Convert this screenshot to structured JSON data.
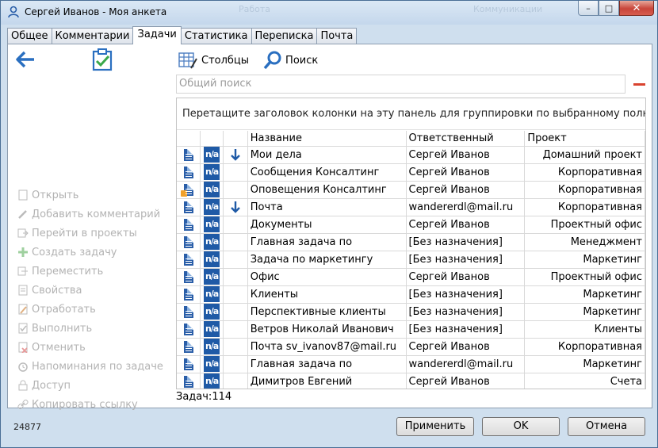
{
  "window": {
    "title": "Сергей Иванов - Моя анкета",
    "ghost_left": "Работа",
    "ghost_right": "Коммуникации",
    "controls": {
      "minimize": "–",
      "maximize": "□",
      "close": "✕"
    }
  },
  "tabs": [
    {
      "label": "Общее",
      "active": false
    },
    {
      "label": "Комментарии",
      "active": false
    },
    {
      "label": "Задачи",
      "active": true
    },
    {
      "label": "Статистика",
      "active": false
    },
    {
      "label": "Переписка",
      "active": false
    },
    {
      "label": "Почта",
      "active": false
    }
  ],
  "toolbar": {
    "columns_label": "Столбцы",
    "search_label": "Поиск"
  },
  "search": {
    "placeholder": "Общий поиск"
  },
  "group_panel_text": "Перетащите заголовок колонки на эту панель для группировки по выбранному полю",
  "columns": [
    "Название",
    "Ответственный",
    "Проект"
  ],
  "rows": [
    {
      "name": "Мои дела",
      "owner": "Сергей Иванов",
      "project": "Домашний проект",
      "arrow": true,
      "warn": false
    },
    {
      "name": "Сообщения Консалтинг",
      "owner": "Сергей Иванов",
      "project": "Корпоративная",
      "arrow": false,
      "warn": false
    },
    {
      "name": "Оповещения Консалтинг",
      "owner": "Сергей Иванов",
      "project": "Корпоративная",
      "arrow": false,
      "warn": true
    },
    {
      "name": "Почта",
      "owner": "wandererdl@mail.ru",
      "project": "Корпоративная",
      "arrow": true,
      "warn": false
    },
    {
      "name": "Документы",
      "owner": "Сергей Иванов",
      "project": "Проектный офис",
      "arrow": false,
      "warn": false
    },
    {
      "name": "Главная задача по",
      "owner": "[Без назначения]",
      "project": "Менеджмент",
      "arrow": false,
      "warn": false
    },
    {
      "name": "Задача по маркетингу",
      "owner": "[Без назначения]",
      "project": "Маркетинг",
      "arrow": false,
      "warn": false
    },
    {
      "name": "Офис",
      "owner": "Сергей Иванов",
      "project": "Проектный офис",
      "arrow": false,
      "warn": false
    },
    {
      "name": "Клиенты",
      "owner": "[Без назначения]",
      "project": "Маркетинг",
      "arrow": false,
      "warn": false
    },
    {
      "name": "Перспективные клиенты",
      "owner": "[Без назначения]",
      "project": "Маркетинг",
      "arrow": false,
      "warn": false
    },
    {
      "name": "Ветров Николай Иванович",
      "owner": "[Без назначения]",
      "project": "Клиенты",
      "arrow": false,
      "warn": false
    },
    {
      "name": "Почта sv_ivanov87@mail.ru",
      "owner": "Сергей Иванов",
      "project": "Корпоративная",
      "arrow": false,
      "warn": false
    },
    {
      "name": "Главная задача по",
      "owner": "wandererdl@mail.ru",
      "project": "Маркетинг",
      "arrow": false,
      "warn": false
    },
    {
      "name": "Димитров Евгений",
      "owner": "Сергей Иванов",
      "project": "Счета",
      "arrow": false,
      "warn": false
    }
  ],
  "na_icon_text": "n/a",
  "count_text": "Задач:114",
  "side_menu": [
    {
      "label": "Открыть",
      "icon": "open-icon"
    },
    {
      "label": "Добавить комментарий",
      "icon": "pencil-icon"
    },
    {
      "label": "Перейти в проекты",
      "icon": "goto-icon"
    },
    {
      "label": "Создать задачу",
      "icon": "plus-icon"
    },
    {
      "label": "Переместить",
      "icon": "move-icon"
    },
    {
      "label": "Свойства",
      "icon": "properties-icon"
    },
    {
      "label": "Отработать",
      "icon": "work-icon"
    },
    {
      "label": "Выполнить",
      "icon": "complete-icon"
    },
    {
      "label": "Отменить",
      "icon": "cancel-icon"
    },
    {
      "label": "Напоминания по задаче",
      "icon": "alarm-icon"
    },
    {
      "label": "Доступ",
      "icon": "lock-icon"
    },
    {
      "label": "Копировать ссылку",
      "icon": "link-icon"
    }
  ],
  "footer": {
    "id_text": "24877",
    "apply": "Применить",
    "ok": "OK",
    "cancel": "Отмена"
  },
  "colors": {
    "accent_blue": "#1f5aa6",
    "minus_red": "#d9432f",
    "disabled_text": "#b3b3b3"
  }
}
